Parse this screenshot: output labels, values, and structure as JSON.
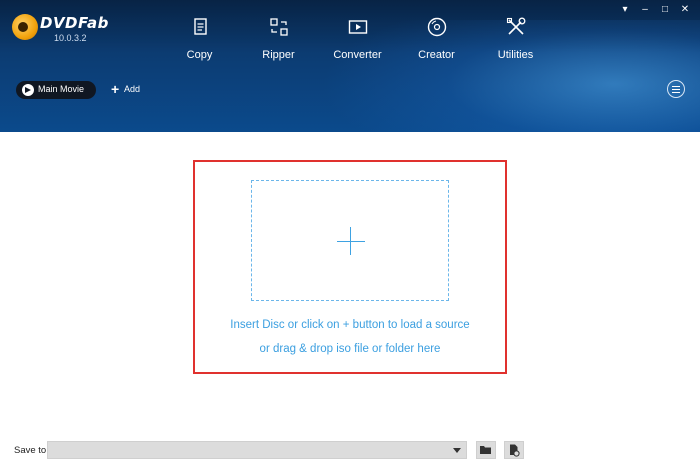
{
  "app": {
    "name": "DVDFab",
    "version": "10.0.3.2"
  },
  "nav": {
    "items": [
      {
        "label": "Copy",
        "icon": "copy-icon"
      },
      {
        "label": "Ripper",
        "icon": "ripper-icon"
      },
      {
        "label": "Converter",
        "icon": "converter-icon"
      },
      {
        "label": "Creator",
        "icon": "creator-icon"
      },
      {
        "label": "Utilities",
        "icon": "utilities-icon"
      }
    ]
  },
  "window": {
    "controls": [
      "dock-icon",
      "minimize-icon",
      "restore-icon",
      "close-icon"
    ]
  },
  "toolbar": {
    "mode_label": "Main Movie",
    "add_label": "Add"
  },
  "dropzone": {
    "line1": "Insert Disc or click on + button to load a source",
    "line2": "or drag & drop iso file or folder here"
  },
  "footer": {
    "save_label": "Save to:",
    "save_value": ""
  },
  "colors": {
    "header": "#0b3f7a",
    "accent_blue": "#3b9fe0",
    "frame_red": "#e0312e"
  }
}
